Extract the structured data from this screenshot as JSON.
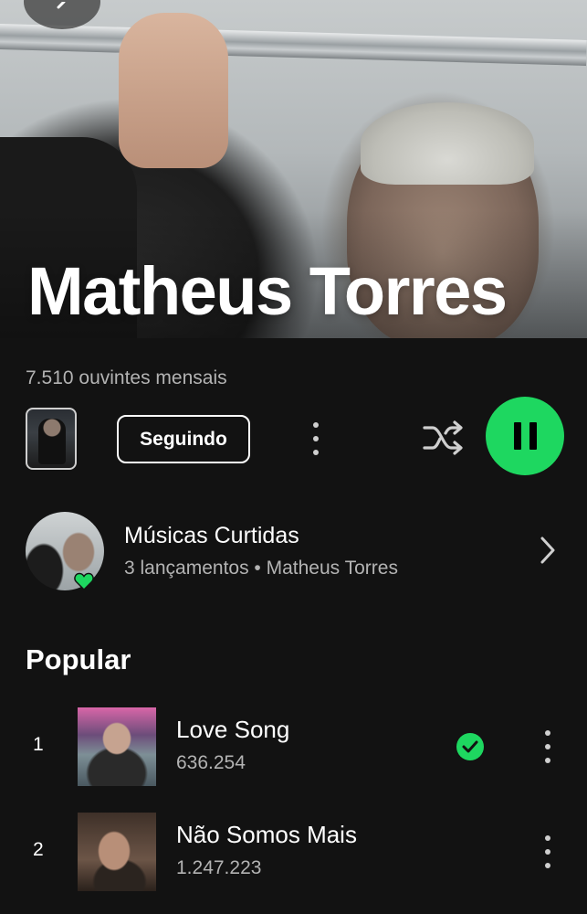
{
  "artist": {
    "name": "Matheus Torres",
    "monthly_listeners": "7.510 ouvintes mensais"
  },
  "actions": {
    "follow_label": "Seguindo"
  },
  "liked_songs": {
    "title": "Músicas Curtidas",
    "subtitle": "3 lançamentos • Matheus Torres"
  },
  "popular": {
    "title": "Popular",
    "tracks": [
      {
        "rank": "1",
        "name": "Love Song",
        "plays": "636.254",
        "saved": true
      },
      {
        "rank": "2",
        "name": "Não Somos Mais",
        "plays": "1.247.223",
        "saved": false
      }
    ]
  },
  "icons": {
    "back": "chevron-left-icon",
    "more": "more-vertical-icon",
    "shuffle": "shuffle-icon",
    "pause": "pause-icon",
    "liked": "heart-icon",
    "open": "chevron-right-icon",
    "saved": "check-circle-icon"
  },
  "colors": {
    "accent": "#1ed760",
    "background": "#121212",
    "secondary_text": "#b3b3b3"
  }
}
